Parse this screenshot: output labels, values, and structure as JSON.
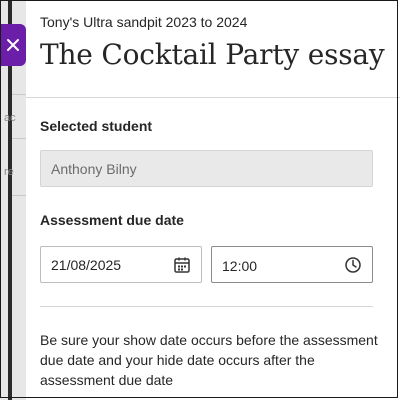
{
  "panel": {
    "course_title": "Tony's Ultra sandpit 2023 to 2024",
    "page_title": "The Cocktail Party essay"
  },
  "background": {
    "fragments": [
      "ac",
      "re"
    ]
  },
  "close_tab": {
    "icon": "close-icon",
    "color": "#6b1fa8"
  },
  "selected_student": {
    "label": "Selected student",
    "value": "Anthony Bilny"
  },
  "due_date": {
    "label": "Assessment due date",
    "date_value": "21/08/2025",
    "date_icon": "calendar-icon",
    "time_value": "12:00",
    "time_icon": "clock-icon"
  },
  "info": {
    "text": "Be sure your show date occurs before the assessment due date and your hide date occurs after the assessment due date"
  }
}
